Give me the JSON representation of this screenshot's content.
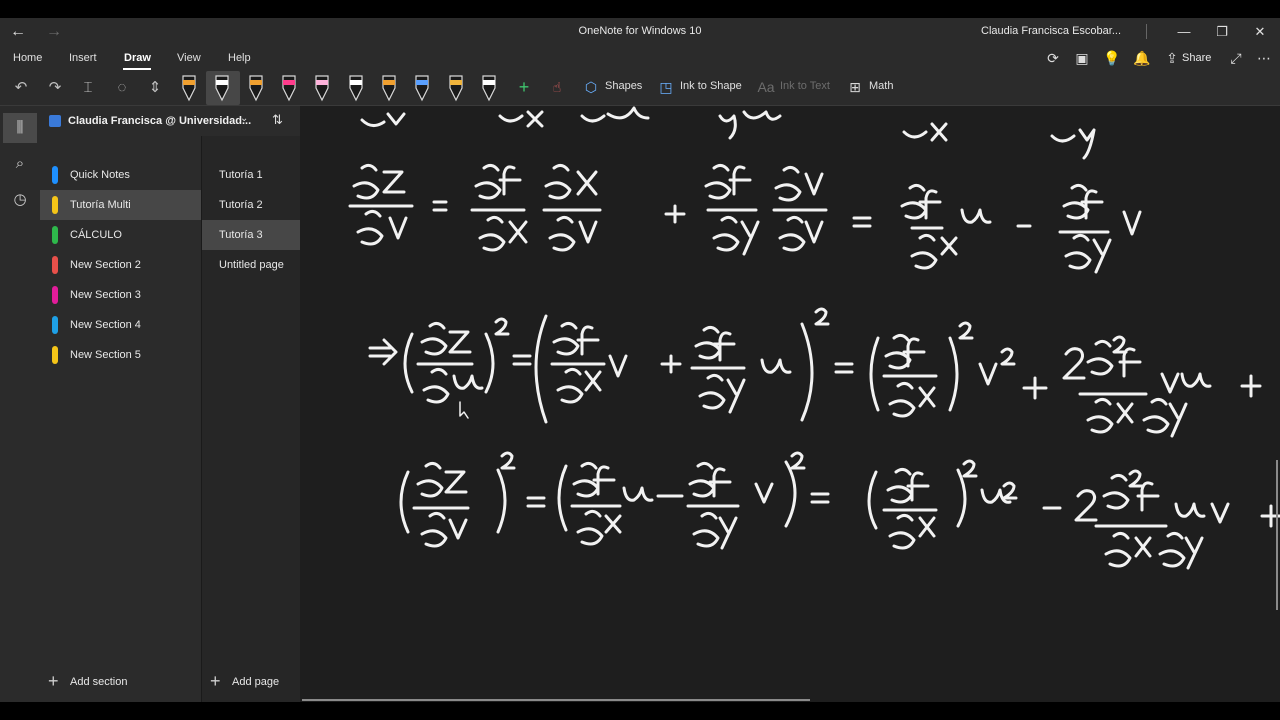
{
  "titlebar": {
    "app_title": "OneNote for Windows 10",
    "user_name": "Claudia Francisca Escobar..."
  },
  "ribbon": {
    "tabs": [
      {
        "label": "Home",
        "active": false
      },
      {
        "label": "Insert",
        "active": false
      },
      {
        "label": "Draw",
        "active": true
      },
      {
        "label": "View",
        "active": false
      },
      {
        "label": "Help",
        "active": false
      }
    ],
    "share_label": "Share"
  },
  "toolbar": {
    "pen_colors": [
      "#f0a030",
      "#ffffff",
      "#f0a030",
      "#ff3c8c",
      "#ffb4dc",
      "#ffffff",
      "#f0a030",
      "#5aa0ff",
      "#f0b43c",
      "#ffffff"
    ],
    "shapes_label": "Shapes",
    "ink_to_shape_label": "Ink to Shape",
    "ink_to_text_label": "Ink to Text",
    "math_label": "Math"
  },
  "notebook": {
    "title": "Claudia Francisca @ Universidad..."
  },
  "sections": [
    {
      "label": "Quick Notes",
      "color": "#1e90ff",
      "active": false
    },
    {
      "label": "Tutoría Multi",
      "color": "#f5c518",
      "active": true
    },
    {
      "label": "CÁLCULO",
      "color": "#2eb84b",
      "active": false
    },
    {
      "label": "New Section 2",
      "color": "#e8504a",
      "active": false
    },
    {
      "label": "New Section 3",
      "color": "#e21c9a",
      "active": false
    },
    {
      "label": "New Section 4",
      "color": "#1ea0e6",
      "active": false
    },
    {
      "label": "New Section 5",
      "color": "#f5c518",
      "active": false
    }
  ],
  "pages": [
    {
      "label": "Tutoría 1",
      "active": false
    },
    {
      "label": "Tutoría 2",
      "active": false
    },
    {
      "label": "Tutoría 3",
      "active": true
    },
    {
      "label": "Untitled page",
      "active": false
    }
  ],
  "add_section_label": "Add section",
  "add_page_label": "Add page"
}
